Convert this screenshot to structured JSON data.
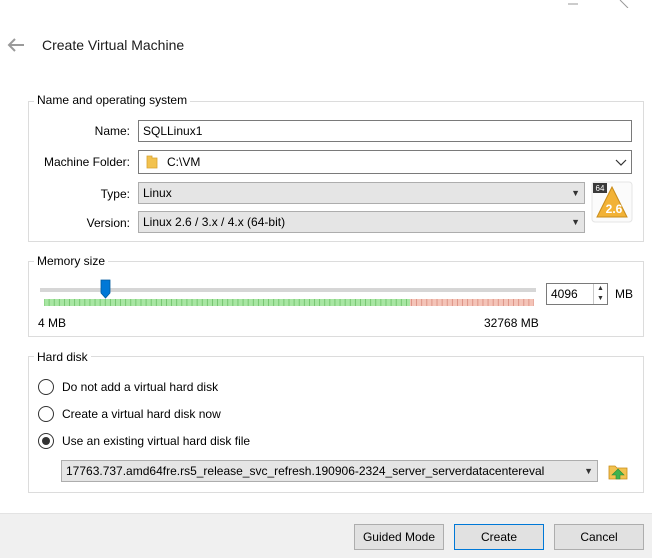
{
  "window": {
    "title": "Create Virtual Machine"
  },
  "name_os": {
    "group_label": "Name and operating system",
    "name_label": "Name:",
    "name_value": "SQLLinux1",
    "folder_label": "Machine Folder:",
    "folder_value": "C:\\VM",
    "type_label": "Type:",
    "type_value": "Linux",
    "version_label": "Version:",
    "version_value": "Linux 2.6 / 3.x / 4.x (64-bit)",
    "os_badge_top": "64",
    "os_badge_version": "2.6"
  },
  "memory": {
    "group_label": "Memory size",
    "value": "4096",
    "unit": "MB",
    "min_label": "4 MB",
    "max_label": "32768 MB",
    "slider_fraction": 0.125
  },
  "hard_disk": {
    "group_label": "Hard disk",
    "options": [
      {
        "label": "Do not add a virtual hard disk",
        "checked": false
      },
      {
        "label": "Create a virtual hard disk now",
        "checked": false
      },
      {
        "label": "Use an existing virtual hard disk file",
        "checked": true
      }
    ],
    "file_value": "17763.737.amd64fre.rs5_release_svc_refresh.190906-2324_server_serverdatacentereval"
  },
  "buttons": {
    "guided": "Guided Mode",
    "create": "Create",
    "cancel": "Cancel"
  },
  "colors": {
    "accent": "#0078d7",
    "slider_green": "#a8e6a3",
    "slider_red": "#f4b8b0"
  }
}
